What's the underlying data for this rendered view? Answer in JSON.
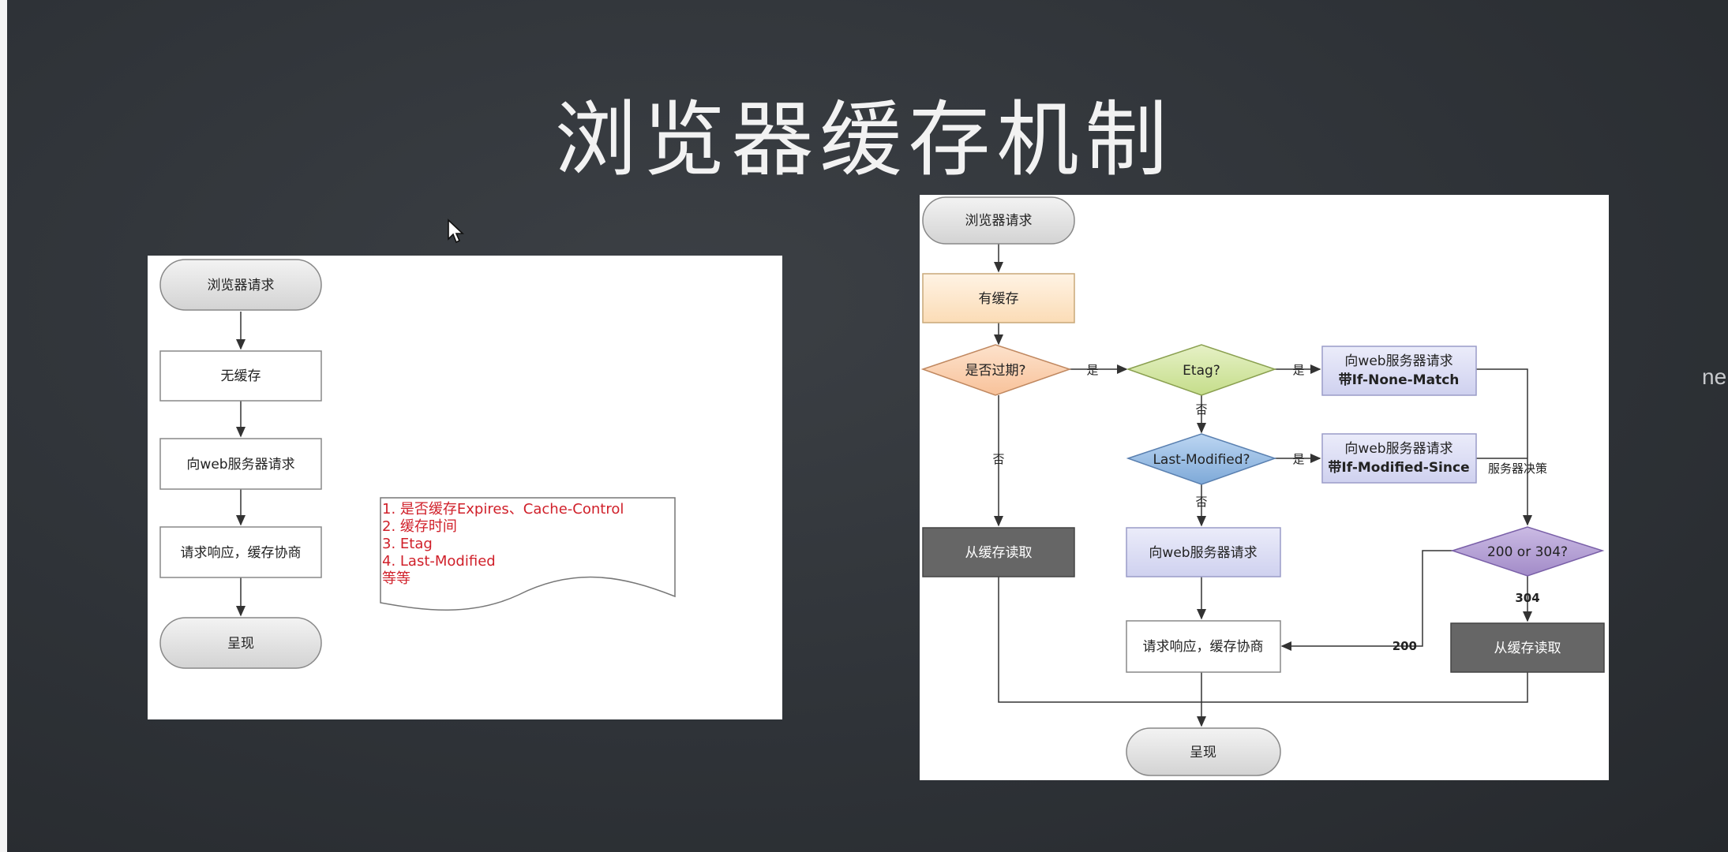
{
  "slide": {
    "title": "浏览器缓存机制",
    "side_text": "ne"
  },
  "left_flow": {
    "start": "浏览器请求",
    "no_cache": "无缓存",
    "request_server": "向web服务器请求",
    "response": "请求响应，缓存协商",
    "render": "呈现",
    "note_lines": [
      "1. 是否缓存Expires、Cache-Control",
      "2. 缓存时间",
      "3. Etag",
      "4. Last-Modified",
      "等等"
    ]
  },
  "right_flow": {
    "start": "浏览器请求",
    "has_cache": "有缓存",
    "expired": "是否过期?",
    "etag": "Etag?",
    "last_modified": "Last-Modified?",
    "req_none_match_1": "向web服务器请求",
    "req_none_match_2": "带If-None-Match",
    "req_modified_1": "向web服务器请求",
    "req_modified_2": "带If-Modified-Since",
    "server_decide": "服务器决策",
    "read_cache_left": "从缓存读取",
    "request_server": "向web服务器请求",
    "status_check": "200 or 304?",
    "read_cache_right": "从缓存读取",
    "response": "请求响应，缓存协商",
    "render": "呈现",
    "label_yes_1": "是",
    "label_yes_2": "是",
    "label_yes_3": "是",
    "label_no_1": "否",
    "label_no_2": "否",
    "label_no_3": "否",
    "label_304": "304",
    "label_200": "200"
  },
  "colors": {
    "terminal_fill": "#e6e6e6",
    "cache_fill": "#fde9d0",
    "expired_fill": "#fbd2b3",
    "etag_fill": "#d6e8a8",
    "lm_fill": "#9cc2e8",
    "request_fill": "#dcddf4",
    "status_fill": "#b7a3d6",
    "read_fill": "#666666",
    "note_text": "#d0202a"
  }
}
